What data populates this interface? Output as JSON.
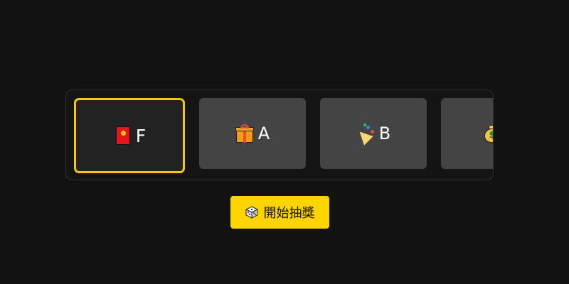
{
  "prize_strip": {
    "cards": [
      {
        "label": "F",
        "icon": "red-envelope-icon",
        "selected": true
      },
      {
        "label": "A",
        "icon": "gift-icon",
        "selected": false
      },
      {
        "label": "B",
        "icon": "party-popper-icon",
        "selected": false
      },
      {
        "label": "",
        "icon": "money-bag-icon",
        "selected": false
      }
    ]
  },
  "draw_button": {
    "label": "開始抽獎",
    "icon": "dice-icon"
  },
  "colors": {
    "background": "#121212",
    "card": "#444444",
    "selected_card": "#222222",
    "highlight": "#f5c518",
    "button": "#ffd400"
  }
}
